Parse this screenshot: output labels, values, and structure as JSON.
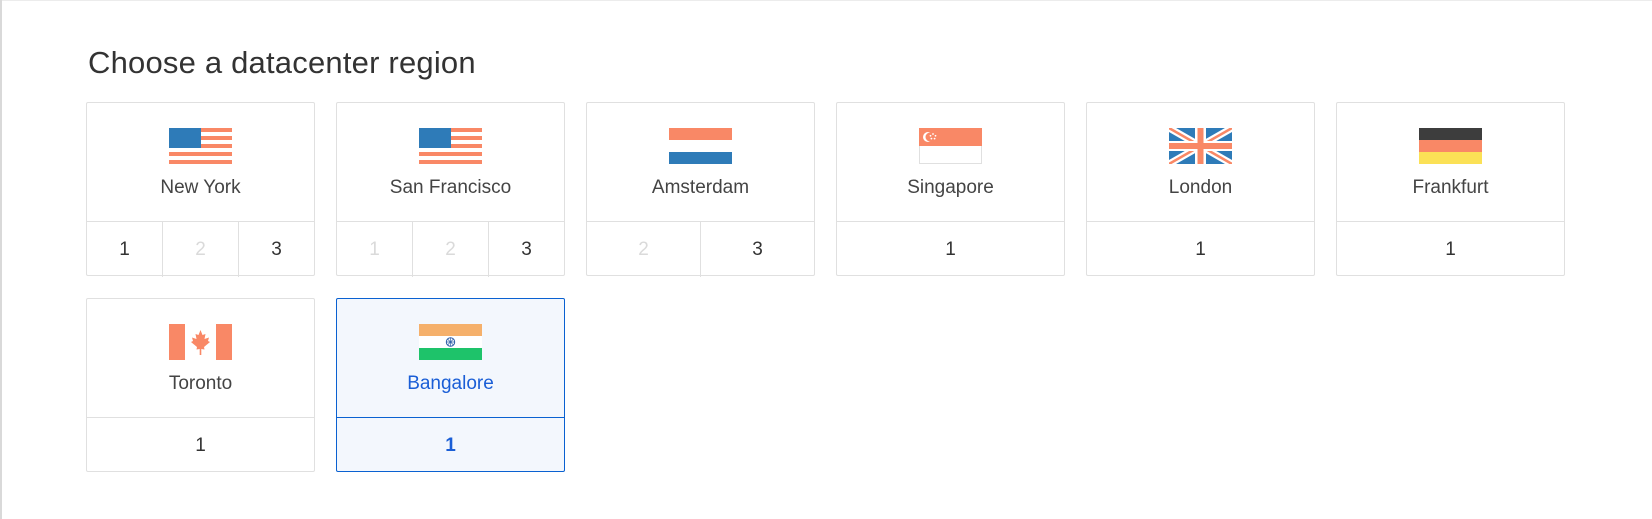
{
  "page": {
    "title": "Choose a datacenter region"
  },
  "colors": {
    "selected_border": "#0a61d1",
    "selected_text": "#1a5ed6",
    "selected_bg": "#f3f7fd",
    "flag_blue": "#2e7bb8",
    "flag_orange": "#f98866",
    "flag_dark": "#3d3d3d",
    "flag_yellow": "#fbe156",
    "flag_saffron": "#f5b06b",
    "flag_green": "#1ec36a"
  },
  "regions": [
    {
      "city": "New York",
      "flag_icon": "us-flag-icon",
      "sizes": [
        {
          "label": "1",
          "available": true
        },
        {
          "label": "2",
          "available": false
        },
        {
          "label": "3",
          "available": true
        }
      ]
    },
    {
      "city": "San Francisco",
      "flag_icon": "us-flag-icon",
      "sizes": [
        {
          "label": "1",
          "available": false
        },
        {
          "label": "2",
          "available": false
        },
        {
          "label": "3",
          "available": true
        }
      ]
    },
    {
      "city": "Amsterdam",
      "flag_icon": "netherlands-flag-icon",
      "sizes": [
        {
          "label": "2",
          "available": false
        },
        {
          "label": "3",
          "available": true
        }
      ]
    },
    {
      "city": "Singapore",
      "flag_icon": "singapore-flag-icon",
      "sizes": [
        {
          "label": "1",
          "available": true
        }
      ]
    },
    {
      "city": "London",
      "flag_icon": "uk-flag-icon",
      "sizes": [
        {
          "label": "1",
          "available": true
        }
      ]
    },
    {
      "city": "Frankfurt",
      "flag_icon": "germany-flag-icon",
      "sizes": [
        {
          "label": "1",
          "available": true
        }
      ]
    },
    {
      "city": "Toronto",
      "flag_icon": "canada-flag-icon",
      "sizes": [
        {
          "label": "1",
          "available": true
        }
      ]
    },
    {
      "city": "Bangalore",
      "flag_icon": "india-flag-icon",
      "selected": true,
      "sizes": [
        {
          "label": "1",
          "available": true
        }
      ]
    }
  ]
}
